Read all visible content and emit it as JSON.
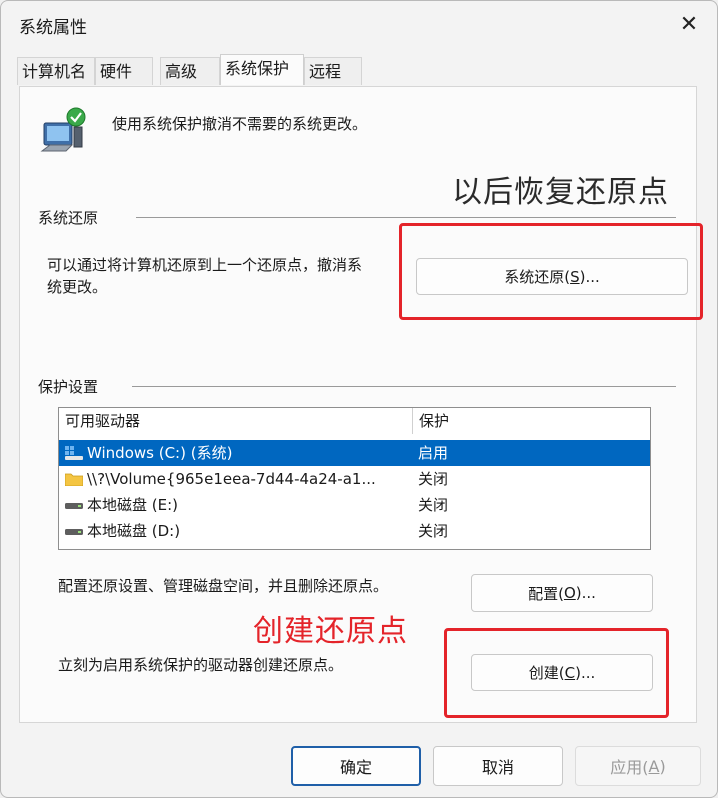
{
  "window": {
    "title": "系统属性",
    "close_glyph": "✕"
  },
  "tabs": [
    {
      "label": "计算机名",
      "active": false
    },
    {
      "label": "硬件",
      "active": false
    },
    {
      "label": "高级",
      "active": false
    },
    {
      "label": "系统保护",
      "active": true
    },
    {
      "label": "远程",
      "active": false
    }
  ],
  "intro": {
    "icon": "system-protection-icon",
    "text": "使用系统保护撤消不需要的系统更改。"
  },
  "annotations": {
    "top": "以后恢复还原点",
    "bottom": "创建还原点",
    "highlight_color": "#e4242a"
  },
  "restore": {
    "section_label": "系统还原",
    "desc_line1": "可以通过将计算机还原到上一个还原点，撤消系",
    "desc_line2": "统更改。",
    "button_prefix": "系统还原(",
    "button_key": "S",
    "button_suffix": ")..."
  },
  "protection": {
    "section_label": "保护设置",
    "columns": [
      "可用驱动器",
      "保护"
    ],
    "drives": [
      {
        "name": "Windows (C:) (系统)",
        "status": "启用",
        "icon": "system-drive-icon",
        "selected": true
      },
      {
        "name": "\\\\?\\Volume{965e1eea-7d44-4a24-a1...",
        "status": "关闭",
        "icon": "folder-icon",
        "selected": false
      },
      {
        "name": "本地磁盘 (E:)",
        "status": "关闭",
        "icon": "hard-drive-icon",
        "selected": false
      },
      {
        "name": "本地磁盘 (D:)",
        "status": "关闭",
        "icon": "hard-drive-icon",
        "selected": false
      }
    ],
    "selection_color": "#0067c0",
    "config_desc": "配置还原设置、管理磁盘空间，并且删除还原点。",
    "config_prefix": "配置(",
    "config_key": "O",
    "config_suffix": ")...",
    "create_desc": "立刻为启用系统保护的驱动器创建还原点。",
    "create_prefix": "创建(",
    "create_key": "C",
    "create_suffix": ")..."
  },
  "footer": {
    "ok": "确定",
    "cancel": "取消",
    "apply_prefix": "应用(",
    "apply_key": "A",
    "apply_suffix": ")"
  }
}
